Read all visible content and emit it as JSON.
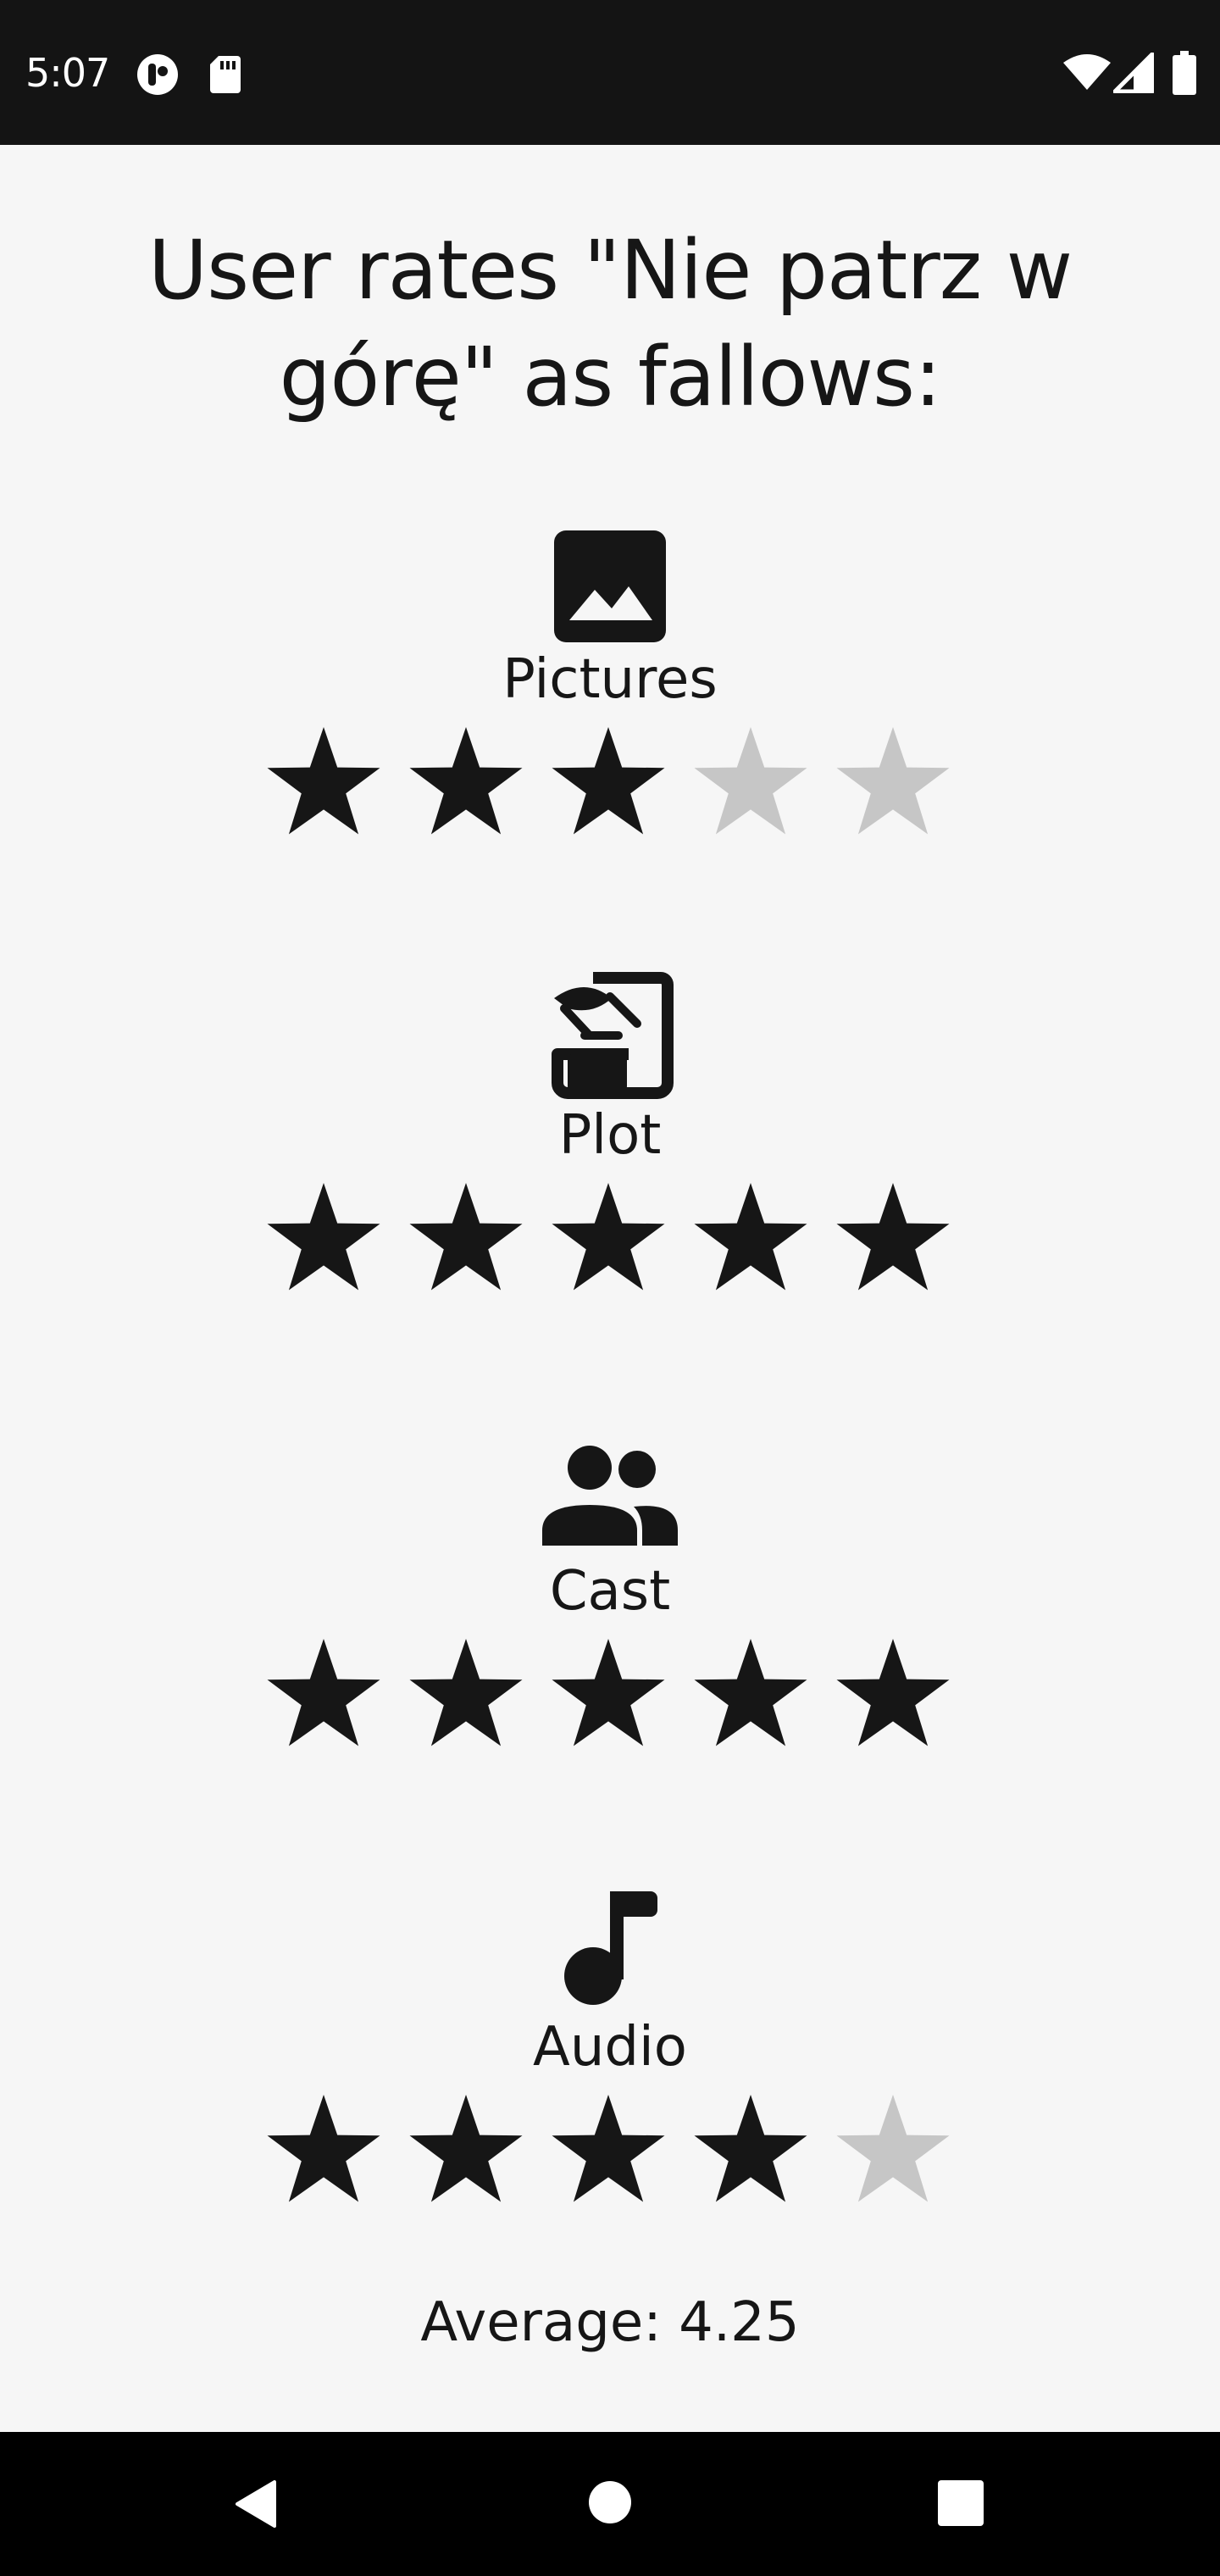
{
  "status_bar": {
    "time": "5:07",
    "left_icons": [
      "notification-app-icon",
      "sd-card-icon"
    ],
    "right_icons": [
      "wifi-icon",
      "cell-signal-icon",
      "battery-icon"
    ]
  },
  "title": "User rates \"Nie patrz w górę\" as fallows:",
  "colors": {
    "star_filled": "#161616",
    "star_empty": "#C6C6C6",
    "background": "#F6F6F6",
    "system_bar": "#141414"
  },
  "max_stars": 5,
  "categories": [
    {
      "label": "Pictures",
      "icon": "image-icon",
      "rating": 3
    },
    {
      "label": "Plot",
      "icon": "script-icon",
      "rating": 5
    },
    {
      "label": "Cast",
      "icon": "people-icon",
      "rating": 5
    },
    {
      "label": "Audio",
      "icon": "music-note-icon",
      "rating": 4
    }
  ],
  "average": "Average: 4.25",
  "nav_bar": {
    "buttons": [
      "back-button",
      "home-button",
      "recents-button"
    ]
  }
}
